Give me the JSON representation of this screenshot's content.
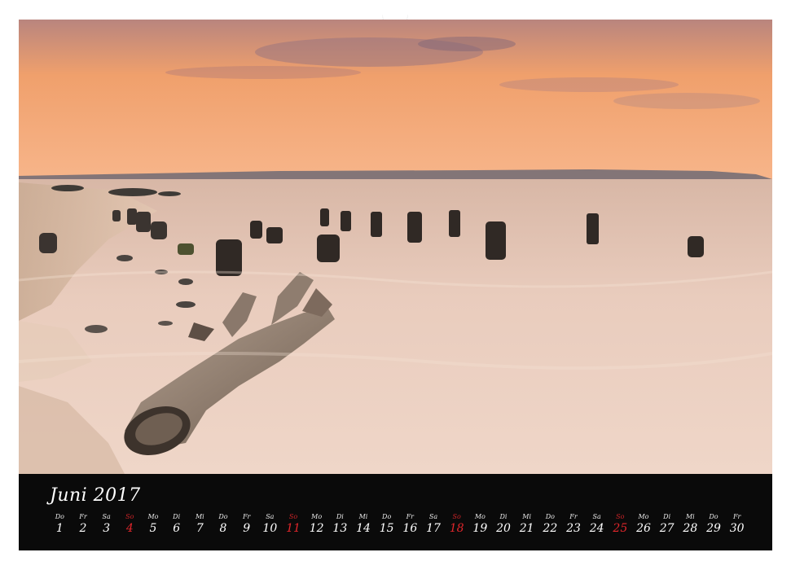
{
  "calendar": {
    "month_label": "Juni 2017",
    "sunday_color": "#e0262b",
    "days": [
      {
        "wd": "Do",
        "d": "1"
      },
      {
        "wd": "Fr",
        "d": "2"
      },
      {
        "wd": "Sa",
        "d": "3"
      },
      {
        "wd": "So",
        "d": "4"
      },
      {
        "wd": "Mo",
        "d": "5"
      },
      {
        "wd": "Di",
        "d": "6"
      },
      {
        "wd": "Mi",
        "d": "7"
      },
      {
        "wd": "Do",
        "d": "8"
      },
      {
        "wd": "Fr",
        "d": "9"
      },
      {
        "wd": "Sa",
        "d": "10"
      },
      {
        "wd": "So",
        "d": "11"
      },
      {
        "wd": "Mo",
        "d": "12"
      },
      {
        "wd": "Di",
        "d": "13"
      },
      {
        "wd": "Mi",
        "d": "14"
      },
      {
        "wd": "Do",
        "d": "15"
      },
      {
        "wd": "Fr",
        "d": "16"
      },
      {
        "wd": "Sa",
        "d": "17"
      },
      {
        "wd": "So",
        "d": "18"
      },
      {
        "wd": "Mo",
        "d": "19"
      },
      {
        "wd": "Di",
        "d": "20"
      },
      {
        "wd": "Mi",
        "d": "21"
      },
      {
        "wd": "Do",
        "d": "22"
      },
      {
        "wd": "Fr",
        "d": "23"
      },
      {
        "wd": "Sa",
        "d": "24"
      },
      {
        "wd": "So",
        "d": "25"
      },
      {
        "wd": "Mo",
        "d": "26"
      },
      {
        "wd": "Di",
        "d": "27"
      },
      {
        "wd": "Mi",
        "d": "28"
      },
      {
        "wd": "Do",
        "d": "29"
      },
      {
        "wd": "Fr",
        "d": "30"
      }
    ]
  }
}
